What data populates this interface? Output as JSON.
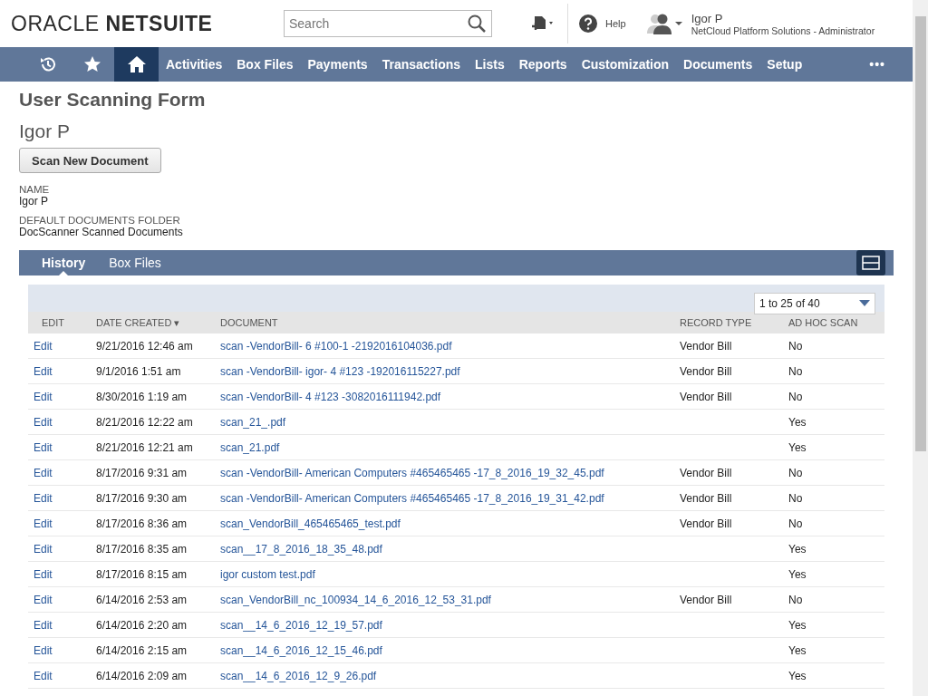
{
  "header": {
    "logo_left": "ORACLE",
    "logo_right": "NETSUITE",
    "search": {
      "placeholder": "Search"
    },
    "help": "Help",
    "user": {
      "name": "Igor P",
      "role": "NetCloud Platform Solutions - Administrator"
    }
  },
  "nav": {
    "items": [
      {
        "kind": "recent",
        "selected": false
      },
      {
        "kind": "star",
        "selected": false
      },
      {
        "kind": "home",
        "selected": true
      },
      {
        "kind": "text",
        "label": "Activities",
        "selected": false
      },
      {
        "kind": "text",
        "label": "Box Files",
        "selected": false
      },
      {
        "kind": "text",
        "label": "Payments",
        "selected": false
      },
      {
        "kind": "text",
        "label": "Transactions",
        "selected": false
      },
      {
        "kind": "text",
        "label": "Lists",
        "selected": false
      },
      {
        "kind": "text",
        "label": "Reports",
        "selected": false
      },
      {
        "kind": "text",
        "label": "Customization",
        "selected": false
      },
      {
        "kind": "text",
        "label": "Documents",
        "selected": false
      },
      {
        "kind": "text",
        "label": "Setup",
        "selected": false
      },
      {
        "kind": "more",
        "label": "•••",
        "selected": false
      }
    ]
  },
  "page": {
    "title": "User Scanning Form",
    "record_name": "Igor P",
    "button": "Scan New Document",
    "fields": [
      {
        "label": "NAME",
        "value": "Igor P"
      },
      {
        "label": "DEFAULT DOCUMENTS FOLDER",
        "value": "DocScanner Scanned Documents"
      }
    ]
  },
  "subtabs": [
    {
      "label": "History",
      "selected": true
    },
    {
      "label": "Box Files",
      "selected": false
    }
  ],
  "table": {
    "pager": "1 to 25 of 40",
    "columns": [
      "EDIT",
      "DATE CREATED ▾",
      "DOCUMENT",
      "RECORD TYPE",
      "AD HOC SCAN"
    ],
    "rows": [
      {
        "edit": "Edit",
        "date": "9/21/2016 12:46 am",
        "document": "scan -VendorBill- 6 #100-1 -2192016104036.pdf",
        "record_type": "Vendor Bill",
        "ad_hoc": "No"
      },
      {
        "edit": "Edit",
        "date": "9/1/2016 1:51 am",
        "document": "scan -VendorBill- igor- 4 #123 -192016115227.pdf",
        "record_type": "Vendor Bill",
        "ad_hoc": "No"
      },
      {
        "edit": "Edit",
        "date": "8/30/2016 1:19 am",
        "document": "scan -VendorBill- 4 #123 -3082016111942.pdf",
        "record_type": "Vendor Bill",
        "ad_hoc": "No"
      },
      {
        "edit": "Edit",
        "date": "8/21/2016 12:22 am",
        "document": "scan_21_.pdf",
        "ad_hoc": "Yes"
      },
      {
        "edit": "Edit",
        "date": "8/21/2016 12:21 am",
        "document": "scan_21.pdf",
        "ad_hoc": "Yes"
      },
      {
        "edit": "Edit",
        "date": "8/17/2016 9:31 am",
        "document": "scan -VendorBill- American Computers #465465465 -17_8_2016_19_32_45.pdf",
        "record_type": "Vendor Bill",
        "ad_hoc": "No"
      },
      {
        "edit": "Edit",
        "date": "8/17/2016 9:30 am",
        "document": "scan -VendorBill- American Computers #465465465 -17_8_2016_19_31_42.pdf",
        "record_type": "Vendor Bill",
        "ad_hoc": "No"
      },
      {
        "edit": "Edit",
        "date": "8/17/2016 8:36 am",
        "document": "scan_VendorBill_465465465_test.pdf",
        "record_type": "Vendor Bill",
        "ad_hoc": "No"
      },
      {
        "edit": "Edit",
        "date": "8/17/2016 8:35 am",
        "document": "scan__17_8_2016_18_35_48.pdf",
        "ad_hoc": "Yes"
      },
      {
        "edit": "Edit",
        "date": "8/17/2016 8:15 am",
        "document": "igor custom test.pdf",
        "ad_hoc": "Yes"
      },
      {
        "edit": "Edit",
        "date": "6/14/2016 2:53 am",
        "document": "scan_VendorBill_nc_100934_14_6_2016_12_53_31.pdf",
        "record_type": "Vendor Bill",
        "ad_hoc": "No"
      },
      {
        "edit": "Edit",
        "date": "6/14/2016 2:20 am",
        "document": "scan__14_6_2016_12_19_57.pdf",
        "ad_hoc": "Yes"
      },
      {
        "edit": "Edit",
        "date": "6/14/2016 2:15 am",
        "document": "scan__14_6_2016_12_15_46.pdf",
        "ad_hoc": "Yes"
      },
      {
        "edit": "Edit",
        "date": "6/14/2016 2:09 am",
        "document": "scan__14_6_2016_12_9_26.pdf",
        "ad_hoc": "Yes"
      }
    ]
  }
}
